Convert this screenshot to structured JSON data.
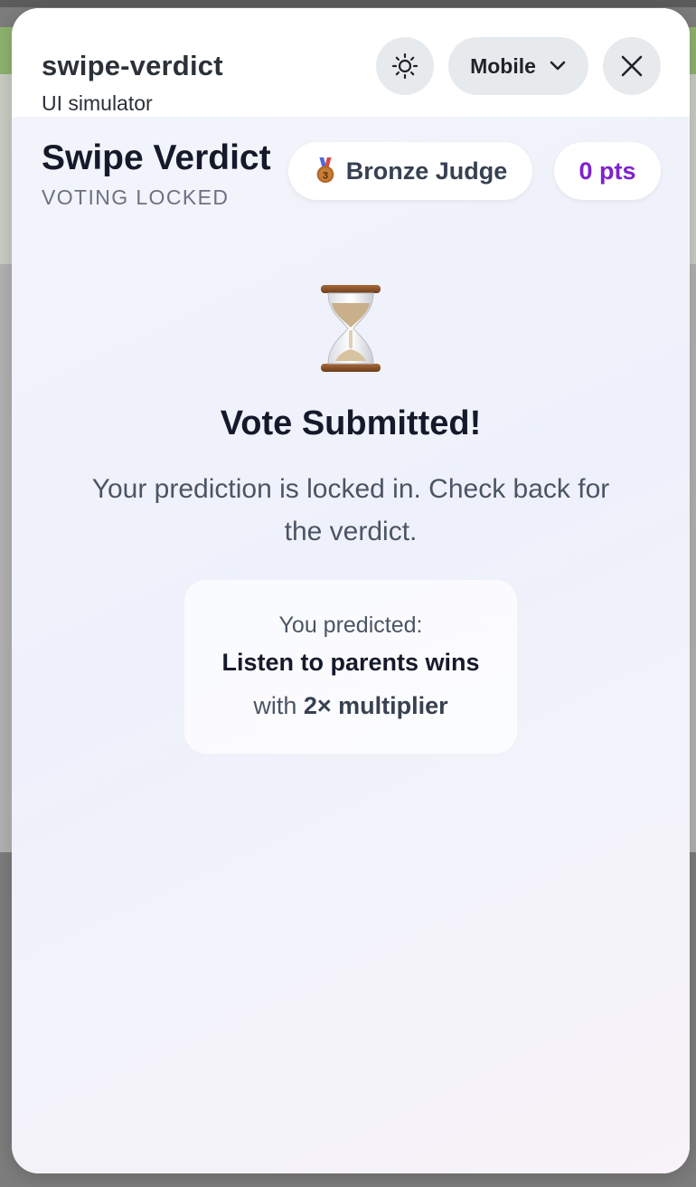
{
  "simulator": {
    "app_name": "swipe-verdict",
    "subtitle": "UI simulator",
    "device_label": "Mobile",
    "theme_icon": "sun-icon",
    "close_icon": "close-icon"
  },
  "app": {
    "title": "Swipe Verdict",
    "status": "VOTING LOCKED",
    "rank": {
      "icon": "bronze-medal-icon",
      "label": "Bronze Judge"
    },
    "points": "0 pts",
    "colors": {
      "points": "#7e22ce",
      "medal": "#b06a2a"
    }
  },
  "confirmation": {
    "icon": "hourglass-icon",
    "headline": "Vote Submitted!",
    "message": "Your prediction is locked in. Check back for the verdict.",
    "card": {
      "label": "You predicted:",
      "choice": "Listen to parents wins",
      "multiplier_prefix": "with",
      "multiplier": "2× multiplier"
    }
  }
}
